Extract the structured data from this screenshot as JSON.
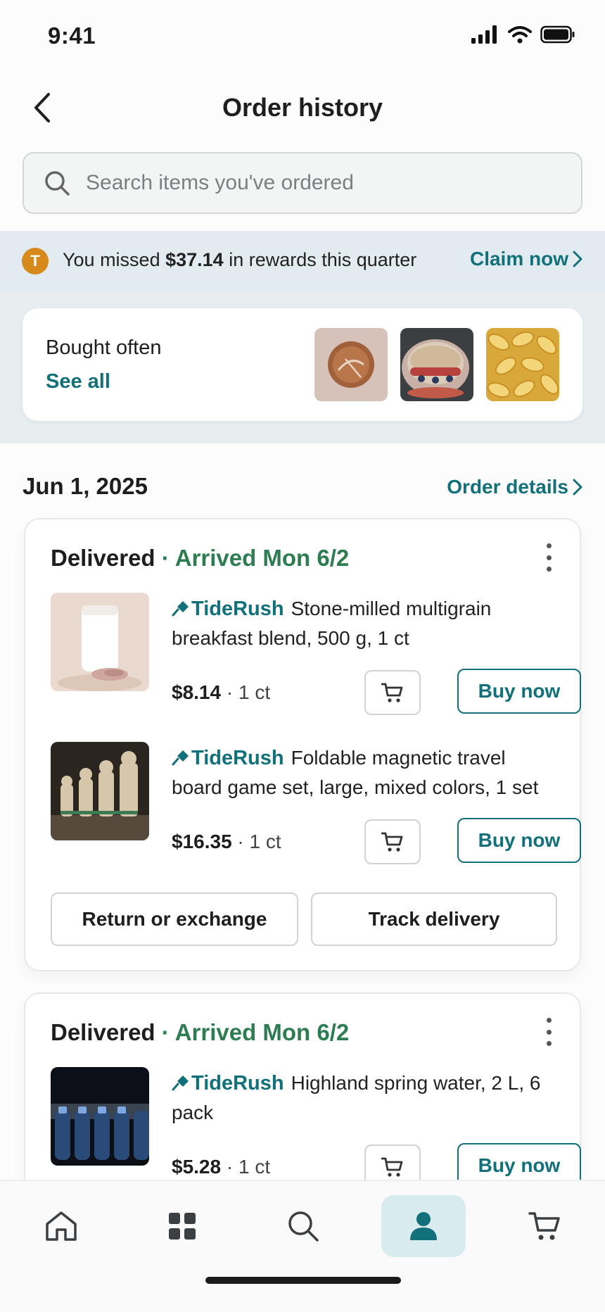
{
  "status_bar": {
    "time": "9:41"
  },
  "header": {
    "title": "Order history"
  },
  "search": {
    "placeholder": "Search items you've ordered"
  },
  "rewards": {
    "coin_letter": "T",
    "text_before": "You missed ",
    "amount": "$37.14",
    "text_after": " in rewards this quarter",
    "claim_label": "Claim now"
  },
  "bought_often": {
    "title": "Bought often",
    "see_all": "See all"
  },
  "order_group": {
    "date": "Jun 1, 2025",
    "details_label": "Order details"
  },
  "orders": [
    {
      "status": "Delivered",
      "arrival": " · Arrived Mon 6/2",
      "items": [
        {
          "brand": "TideRush",
          "description": "Stone-milled multigrain breakfast blend, 500 g, 1 ct",
          "price": "$8.14",
          "qty": " · 1 ct",
          "buy_label": "Buy now"
        },
        {
          "brand": "TideRush",
          "description": "Foldable magnetic travel board game set, large, mixed colors, 1 set",
          "price": "$16.35",
          "qty": " · 1 ct",
          "buy_label": "Buy now"
        }
      ],
      "actions": {
        "return_label": "Return or exchange",
        "track_label": "Track delivery"
      }
    },
    {
      "status": "Delivered",
      "arrival": " · Arrived Mon 6/2",
      "items": [
        {
          "brand": "TideRush",
          "description": "Highland spring water, 2 L, 6 pack",
          "price": "$5.28",
          "qty": " · 1 ct",
          "buy_label": "Buy now"
        }
      ]
    }
  ],
  "nav": {
    "items": [
      "home-icon",
      "categories-icon",
      "search-icon",
      "account-icon",
      "cart-icon"
    ],
    "active": "account-icon"
  },
  "colors": {
    "accent": "#11707a",
    "arrived": "#2e7d52",
    "coin": "#d68a1c",
    "rewards_bg": "#e2ecf0"
  }
}
